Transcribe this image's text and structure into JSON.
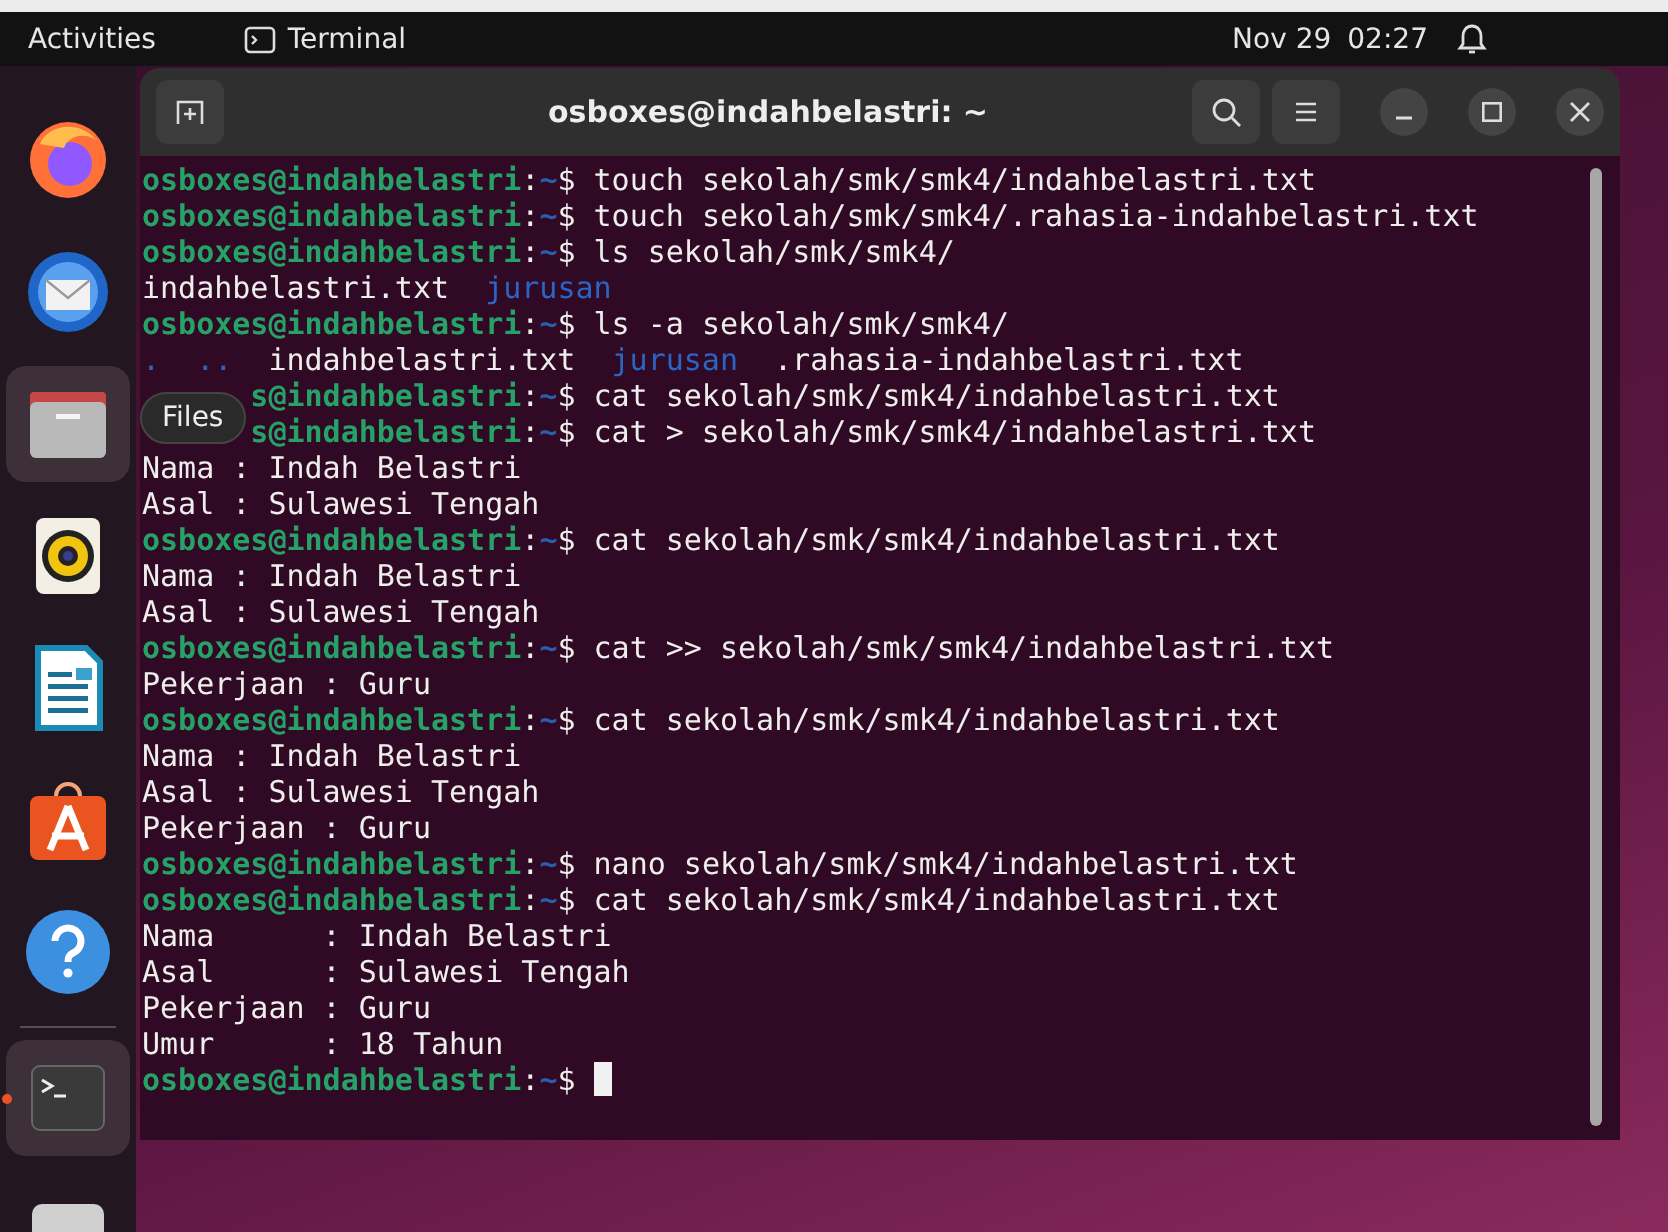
{
  "top_bar": {
    "activities": "Activities",
    "app_name": "Terminal",
    "date": "Nov 29",
    "time": "02:27"
  },
  "dock": {
    "items": [
      {
        "kind": "firefox",
        "selected": false
      },
      {
        "kind": "mail",
        "selected": false
      },
      {
        "kind": "files",
        "selected": true
      },
      {
        "kind": "music",
        "selected": false
      },
      {
        "kind": "writer",
        "selected": false
      },
      {
        "kind": "store",
        "selected": false
      },
      {
        "kind": "help",
        "selected": false
      },
      {
        "kind": "divider"
      },
      {
        "kind": "terminal",
        "selected": true,
        "running": true
      },
      {
        "kind": "disk",
        "selected": false
      }
    ],
    "tooltip": "Files"
  },
  "window": {
    "title": "osboxes@indahbelastri: ~"
  },
  "terminal": {
    "lines": [
      {
        "kind": "prompt",
        "user": "osboxes@indahbelastri",
        "sep": ":",
        "path": "~",
        "sign": "$",
        "command": "touch sekolah/smk/smk4/indahbelastri.txt"
      },
      {
        "kind": "prompt",
        "user": "osboxes@indahbelastri",
        "sep": ":",
        "path": "~",
        "sign": "$",
        "command": "touch sekolah/smk/smk4/.rahasia-indahbelastri.txt"
      },
      {
        "kind": "prompt",
        "user": "osboxes@indahbelastri",
        "sep": ":",
        "path": "~",
        "sign": "$",
        "command": "ls sekolah/smk/smk4/"
      },
      {
        "kind": "listing",
        "entries": [
          {
            "kind": "file",
            "text": "indahbelastri.txt"
          },
          {
            "kind": "directory",
            "text": "jurusan"
          }
        ]
      },
      {
        "kind": "prompt",
        "user": "osboxes@indahbelastri",
        "sep": ":",
        "path": "~",
        "sign": "$",
        "command": "ls -a sekolah/smk/smk4/"
      },
      {
        "kind": "listing",
        "entries": [
          {
            "kind": "directory",
            "text": "."
          },
          {
            "kind": "directory",
            "text": ".."
          },
          {
            "kind": "file",
            "text": "indahbelastri.txt"
          },
          {
            "kind": "directory",
            "text": "jurusan"
          },
          {
            "kind": "file",
            "text": ".rahasia-indahbelastri.txt"
          }
        ]
      },
      {
        "kind": "prompt",
        "covered": true,
        "user": "s@indahbelastri",
        "sep": ":",
        "path": "~",
        "sign": "$",
        "command": "cat sekolah/smk/smk4/indahbelastri.txt"
      },
      {
        "kind": "prompt",
        "covered": true,
        "user": "s@indahbelastri",
        "sep": ":",
        "path": "~",
        "sign": "$",
        "command": "cat > sekolah/smk/smk4/indahbelastri.txt"
      },
      {
        "kind": "output",
        "text": "Nama : Indah Belastri"
      },
      {
        "kind": "output",
        "text": "Asal : Sulawesi Tengah"
      },
      {
        "kind": "prompt",
        "user": "osboxes@indahbelastri",
        "sep": ":",
        "path": "~",
        "sign": "$",
        "command": "cat sekolah/smk/smk4/indahbelastri.txt"
      },
      {
        "kind": "output",
        "text": "Nama : Indah Belastri"
      },
      {
        "kind": "output",
        "text": "Asal : Sulawesi Tengah"
      },
      {
        "kind": "prompt",
        "user": "osboxes@indahbelastri",
        "sep": ":",
        "path": "~",
        "sign": "$",
        "command": "cat >> sekolah/smk/smk4/indahbelastri.txt"
      },
      {
        "kind": "output",
        "text": "Pekerjaan : Guru"
      },
      {
        "kind": "prompt",
        "user": "osboxes@indahbelastri",
        "sep": ":",
        "path": "~",
        "sign": "$",
        "command": "cat sekolah/smk/smk4/indahbelastri.txt"
      },
      {
        "kind": "output",
        "text": "Nama : Indah Belastri"
      },
      {
        "kind": "output",
        "text": "Asal : Sulawesi Tengah"
      },
      {
        "kind": "output",
        "text": "Pekerjaan : Guru"
      },
      {
        "kind": "prompt",
        "user": "osboxes@indahbelastri",
        "sep": ":",
        "path": "~",
        "sign": "$",
        "command": "nano sekolah/smk/smk4/indahbelastri.txt"
      },
      {
        "kind": "prompt",
        "user": "osboxes@indahbelastri",
        "sep": ":",
        "path": "~",
        "sign": "$",
        "command": "cat sekolah/smk/smk4/indahbelastri.txt"
      },
      {
        "kind": "output",
        "text": "Nama      : Indah Belastri"
      },
      {
        "kind": "output",
        "text": "Asal      : Sulawesi Tengah"
      },
      {
        "kind": "output",
        "text": "Pekerjaan : Guru"
      },
      {
        "kind": "output",
        "text": "Umur      : 18 Tahun"
      },
      {
        "kind": "prompt",
        "user": "osboxes@indahbelastri",
        "sep": ":",
        "path": "~",
        "sign": "$",
        "cursor": true
      }
    ]
  }
}
